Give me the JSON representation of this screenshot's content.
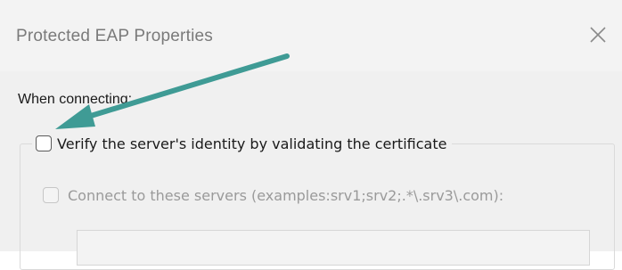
{
  "dialog": {
    "title": "Protected EAP Properties",
    "close_icon": "close-icon"
  },
  "content": {
    "when_connecting_label": "When connecting:",
    "verify_checkbox": {
      "label": "Verify the server's identity by validating the certificate",
      "checked": false
    },
    "connect_servers_checkbox": {
      "label": "Connect to these servers (examples:srv1;srv2;.*\\.srv3\\.com):",
      "checked": false,
      "disabled": true
    },
    "servers_input": {
      "value": "",
      "disabled": true
    }
  },
  "annotation": {
    "arrow_color": "#3f9b95"
  }
}
